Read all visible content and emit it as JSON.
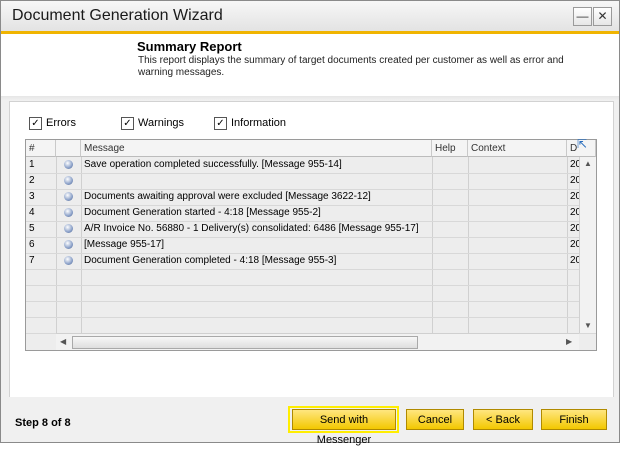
{
  "window": {
    "title": "Document Generation Wizard",
    "minimize_label": "—",
    "close_label": "✕"
  },
  "header": {
    "title": "Summary Report",
    "description": "This report displays the summary of target documents created per customer as well as error and warning messages."
  },
  "filters": [
    {
      "label": "Errors",
      "checked": true
    },
    {
      "label": "Warnings",
      "checked": true
    },
    {
      "label": "Information",
      "checked": true
    }
  ],
  "grid": {
    "columns": [
      "#",
      "",
      "Message",
      "Help",
      "Context",
      "D"
    ],
    "rows": [
      {
        "num": "1",
        "message": "Save operation completed successfully.  [Message 955-14]",
        "date": "20"
      },
      {
        "num": "2",
        "message": "",
        "date": "20"
      },
      {
        "num": "3",
        "message": "Documents awaiting approval were excluded  [Message 3622-12]",
        "date": "20"
      },
      {
        "num": "4",
        "message": "Document Generation started -  4:18  [Message 955-2]",
        "date": "20"
      },
      {
        "num": "5",
        "message": "A/R Invoice No. 56880 - 1 Delivery(s) consolidated: 6486  [Message 955-17]",
        "date": "20"
      },
      {
        "num": "6",
        "message": "[Message 955-17]",
        "date": "20"
      },
      {
        "num": "7",
        "message": "Document Generation completed -  4:18  [Message 955-3]",
        "date": "20"
      }
    ]
  },
  "footer": {
    "step": "Step 8 of 8",
    "buttons": {
      "messenger": "Send with Messenger",
      "cancel": "Cancel",
      "back": "< Back",
      "finish": "Finish"
    }
  },
  "colors": {
    "accent": "#f0b400",
    "button": "#f3c800",
    "highlight": "#ffee00"
  }
}
